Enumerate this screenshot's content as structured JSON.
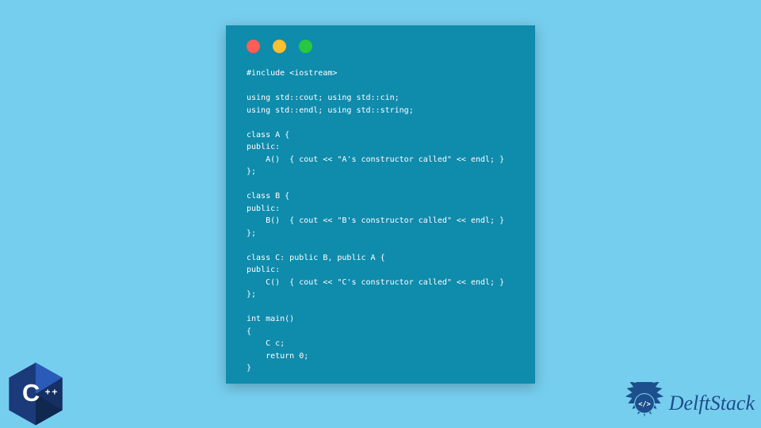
{
  "codeWindow": {
    "trafficLight": {
      "red": "#ff5d55",
      "yellow": "#ffbf2f",
      "green": "#27c83e"
    },
    "codeText": "#include <iostream>\n\nusing std::cout; using std::cin;\nusing std::endl; using std::string;\n\nclass A {\npublic:\n    A()  { cout << \"A's constructor called\" << endl; }\n};\n\nclass B {\npublic:\n    B()  { cout << \"B's constructor called\" << endl; }\n};\n\nclass C: public B, public A {\npublic:\n    C()  { cout << \"C's constructor called\" << endl; }\n};\n\nint main()\n{\n    C c;\n    return 0;\n}"
  },
  "logos": {
    "cppLabel": "C++",
    "delftStackText": "DelftStack"
  },
  "colors": {
    "pageBg": "#76ceee",
    "windowBg": "#0f8bac",
    "codeText": "#ffffff",
    "cppHex": "#1b3a7a",
    "delftBadge": "#1c4f8b"
  }
}
